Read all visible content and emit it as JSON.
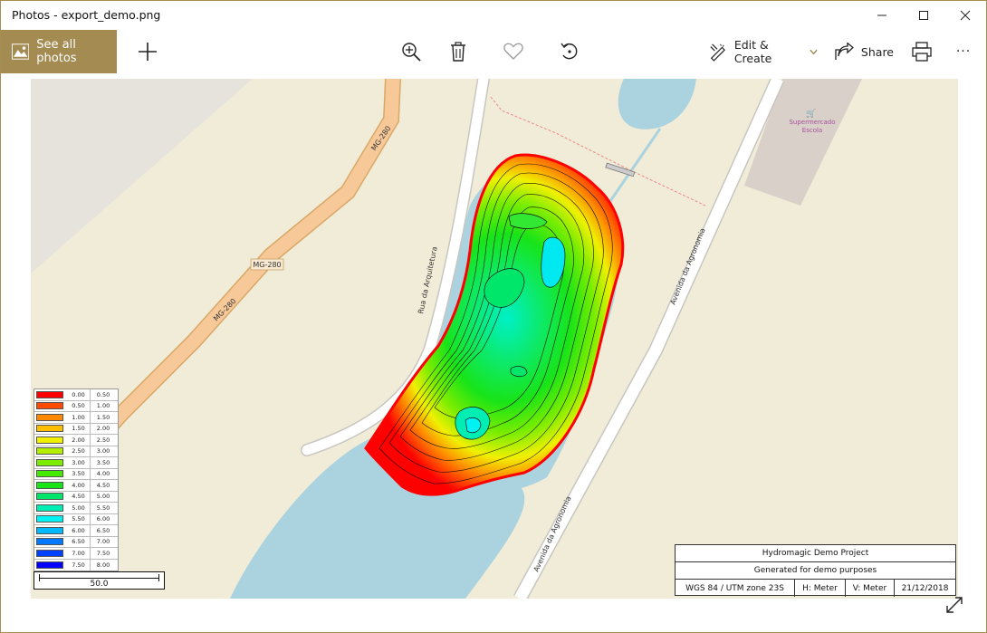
{
  "window": {
    "title": "Photos - export_demo.png",
    "minimize_icon": "minimize-icon",
    "maximize_icon": "maximize-icon",
    "close_icon": "close-icon"
  },
  "toolbar": {
    "see_all_label": "See all photos",
    "edit_create_label": "Edit & Create",
    "share_label": "Share",
    "more_label": "···",
    "icons": [
      "add-icon",
      "zoom-in-icon",
      "delete-icon",
      "heart-icon",
      "rotate-icon",
      "edit-icon",
      "share-icon",
      "print-icon",
      "more-icon",
      "expand-icon"
    ]
  },
  "map": {
    "road_labels": [
      "MG-280",
      "MG-280",
      "MG-280",
      "Rua da Arquitetura",
      "Avenida da Agronomia",
      "Avenida da Agronomia"
    ],
    "poi_line1": "Supermercado",
    "poi_line2": "Escola"
  },
  "legend": {
    "rows": [
      {
        "from": "0.00",
        "to": "0.50",
        "color": "#ff0000"
      },
      {
        "from": "0.50",
        "to": "1.00",
        "color": "#ff4a00"
      },
      {
        "from": "1.00",
        "to": "1.50",
        "color": "#ff8800"
      },
      {
        "from": "1.50",
        "to": "2.00",
        "color": "#ffbe00"
      },
      {
        "from": "2.00",
        "to": "2.50",
        "color": "#f0f000"
      },
      {
        "from": "2.50",
        "to": "3.00",
        "color": "#b4ef00"
      },
      {
        "from": "3.00",
        "to": "3.50",
        "color": "#7ced00"
      },
      {
        "from": "3.50",
        "to": "4.00",
        "color": "#44ea00"
      },
      {
        "from": "4.00",
        "to": "4.50",
        "color": "#18e418"
      },
      {
        "from": "4.50",
        "to": "5.00",
        "color": "#00e66a"
      },
      {
        "from": "5.00",
        "to": "5.50",
        "color": "#00eeb4"
      },
      {
        "from": "5.50",
        "to": "6.00",
        "color": "#00f2f2"
      },
      {
        "from": "6.00",
        "to": "6.50",
        "color": "#00b8ff"
      },
      {
        "from": "6.50",
        "to": "7.00",
        "color": "#0078ff"
      },
      {
        "from": "7.00",
        "to": "7.50",
        "color": "#0040ff"
      },
      {
        "from": "7.50",
        "to": "8.00",
        "color": "#0000ff"
      }
    ]
  },
  "scale": {
    "label": "50.0"
  },
  "info": {
    "project": "Hydromagic Demo Project",
    "description": "Generated for demo purposes",
    "crs": "WGS 84 / UTM zone 23S",
    "h_unit": "H: Meter",
    "v_unit": "V: Meter",
    "date": "21/12/2018"
  }
}
